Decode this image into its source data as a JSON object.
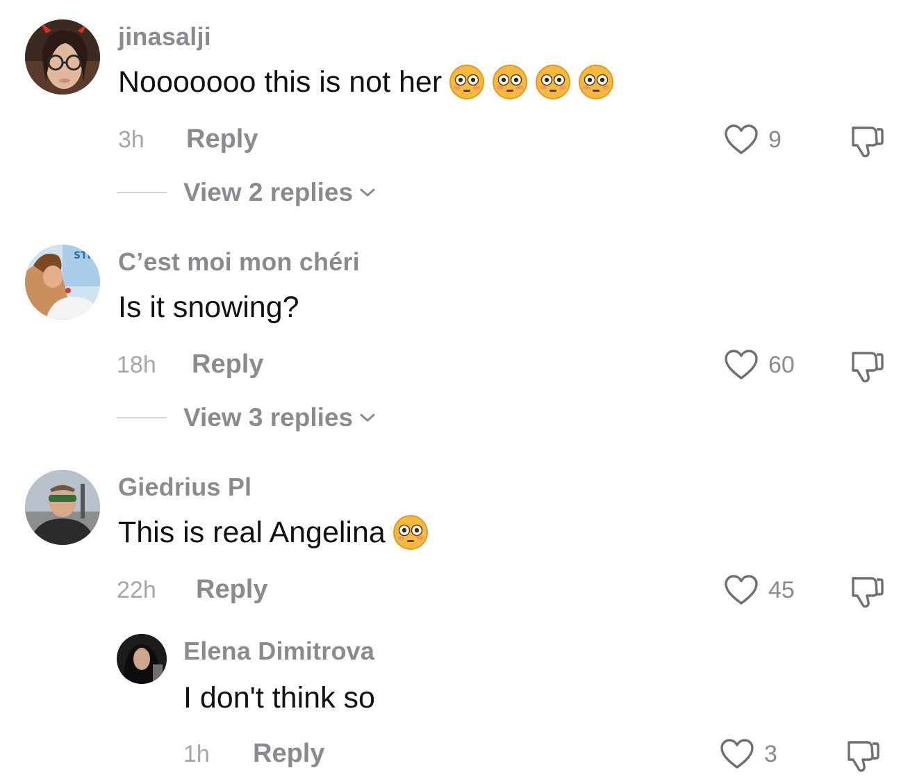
{
  "comments": [
    {
      "username": "jinasalji",
      "text": "Nooooooo this is not her",
      "emoji": [
        "flushed-face",
        "flushed-face",
        "flushed-face",
        "flushed-face"
      ],
      "time": "3h",
      "reply_label": "Reply",
      "likes": "9",
      "view_replies": "View 2 replies"
    },
    {
      "username": "C’est moi mon chéri",
      "text": "Is it snowing?",
      "time": "18h",
      "reply_label": "Reply",
      "likes": "60",
      "view_replies": "View 3 replies"
    },
    {
      "username": "Giedrius Pl",
      "text": "This is real Angelina",
      "emoji": [
        "flushed-face"
      ],
      "time": "22h",
      "reply_label": "Reply",
      "likes": "45"
    }
  ],
  "reply": {
    "username": "Elena Dimitrova",
    "text": "I don't think so",
    "time": "1h",
    "reply_label": "Reply",
    "likes": "3"
  },
  "icons": {
    "like": "heart-outline-icon",
    "dislike": "thumbs-down-icon",
    "expand": "chevron-down-icon",
    "emoji": "flushed-face-emoji"
  },
  "colors": {
    "text": "#111111",
    "muted": "#8a8a8f",
    "time": "#a5a5aa"
  }
}
